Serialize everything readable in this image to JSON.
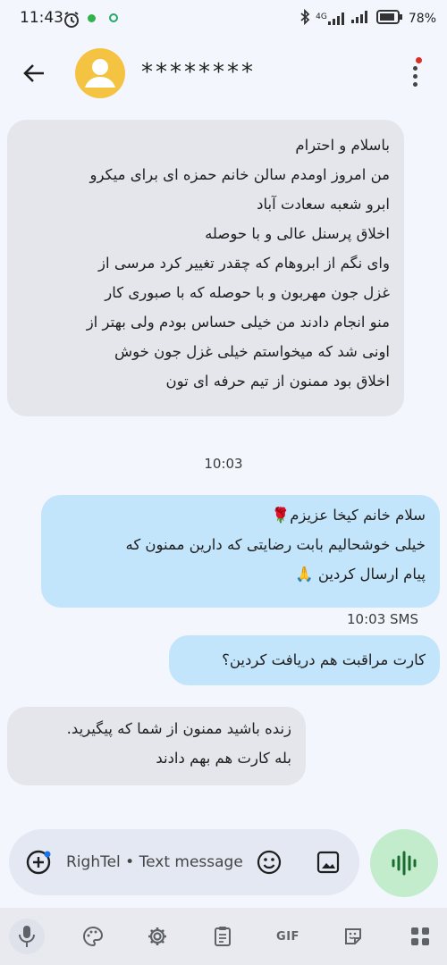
{
  "status_bar": {
    "time": "11:43",
    "network": "4G",
    "battery_percent": "78"
  },
  "header": {
    "contact_name": "********",
    "avatar_color": "#f5c342"
  },
  "messages": [
    {
      "direction": "incoming",
      "text": "باسلام و احترام\nمن امروز اومدم سالن خانم حمزه ای برای میکرو\nابرو شعبه سعادت آباد\nاخلاق پرسنل عالی و با حوصله\nوای نگم از ابروهام که چقدر تغییر کرد مرسی از\nغزل جون مهربون و با حوصله که با صبوری کار\nمنو انجام دادند من خیلی حساس بودم ولی بهتر از\nاونی شد که میخواستم خیلی غزل جون خوش\nاخلاق بود ممنون از تیم حرفه ای تون"
    },
    {
      "direction": "outgoing",
      "text": "سلام خانم کیخا عزیزم🌹\nخیلی خوشحالیم بابت رضایتی که دارین ممنون که\nپیام ارسال کردین 🙏"
    },
    {
      "direction": "outgoing",
      "text": "کارت مراقبت هم دریافت کردین؟"
    },
    {
      "direction": "incoming",
      "text": "زنده باشید ممنون از شما که پیگیرید.\nبله کارت هم بهم دادند"
    }
  ],
  "timestamps": {
    "center": "10:03",
    "outgoing": "10:03 SMS"
  },
  "compose": {
    "placeholder": "RighTel • Text message"
  },
  "colors": {
    "incoming_bubble": "#e4e6eb",
    "outgoing_bubble": "#c3e5fb",
    "voice_button": "#c2eccc",
    "background": "#f3f6fc"
  },
  "keyboard_toolbar": {
    "gif_label": "GIF",
    "icons": [
      "mic-icon",
      "palette-icon",
      "settings-icon",
      "clipboard-icon",
      "gif-icon",
      "sticker-icon",
      "grid-icon"
    ]
  }
}
